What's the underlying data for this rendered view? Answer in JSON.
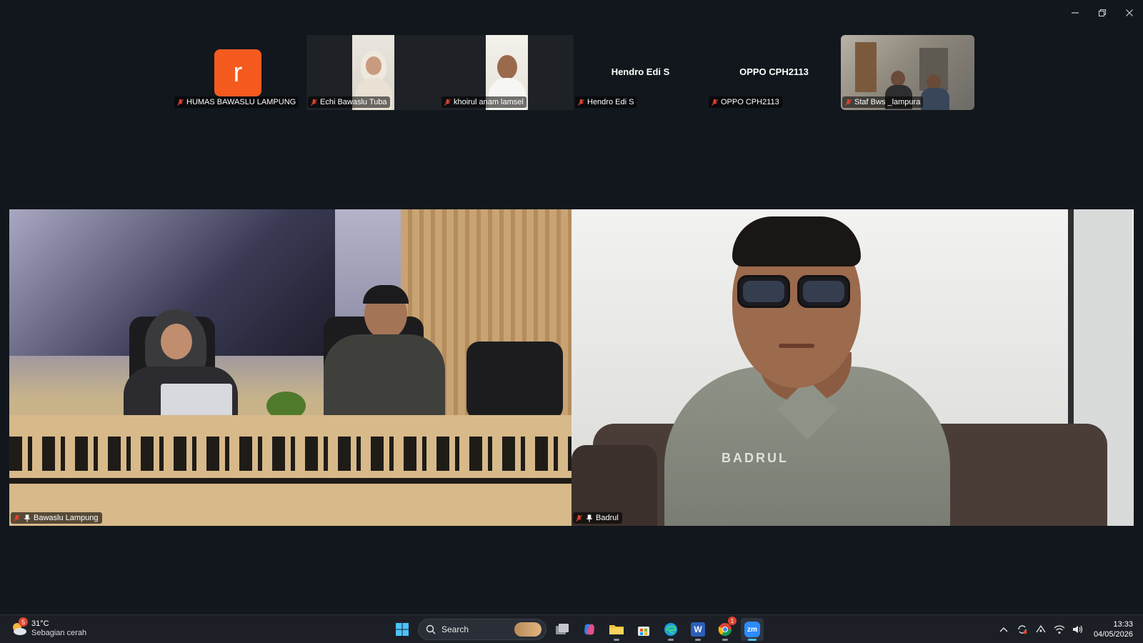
{
  "window": {
    "minimize": "minimize",
    "restore": "restore",
    "close": "close"
  },
  "participants_strip": [
    {
      "name": "HUMAS BAWASLU LAMPUNG",
      "avatar_letter": "r",
      "video": false,
      "center_name": ""
    },
    {
      "name": "Echi Bawaslu Tuba",
      "video": true,
      "center_name": ""
    },
    {
      "name": "khoirul anam lamsel",
      "video": true,
      "center_name": ""
    },
    {
      "name": "Hendro Edi S",
      "video": false,
      "center_name": "Hendro Edi S"
    },
    {
      "name": "OPPO CPH2113",
      "video": false,
      "center_name": "OPPO CPH2113"
    },
    {
      "name": "Staf Bws _lampura",
      "video": true,
      "center_name": ""
    }
  ],
  "main_tiles": [
    {
      "name": "Bawaslu Lampung",
      "pinned": true
    },
    {
      "name": "Badrul",
      "pinned": true,
      "shirt_text": "BADRUL"
    }
  ],
  "taskbar": {
    "weather": {
      "badge": "5",
      "temp": "31°C",
      "desc": "Sebagian cerah"
    },
    "search_placeholder": "Search",
    "apps": [
      "start-icon",
      "task-view-icon",
      "copilot-icon",
      "file-explorer-icon",
      "store-icon",
      "edge-icon",
      "word-icon",
      "chrome-icon",
      "zoom-icon"
    ],
    "chrome_badge": "1",
    "zoom_label": "zm",
    "word_label": "W",
    "clock": {
      "time": "13:33",
      "date": "04/05/2026"
    }
  },
  "colors": {
    "background": "#12171d",
    "avatar": "#f55a1f",
    "muted_red": "#e0432f",
    "taskbar": "#1c2026"
  }
}
